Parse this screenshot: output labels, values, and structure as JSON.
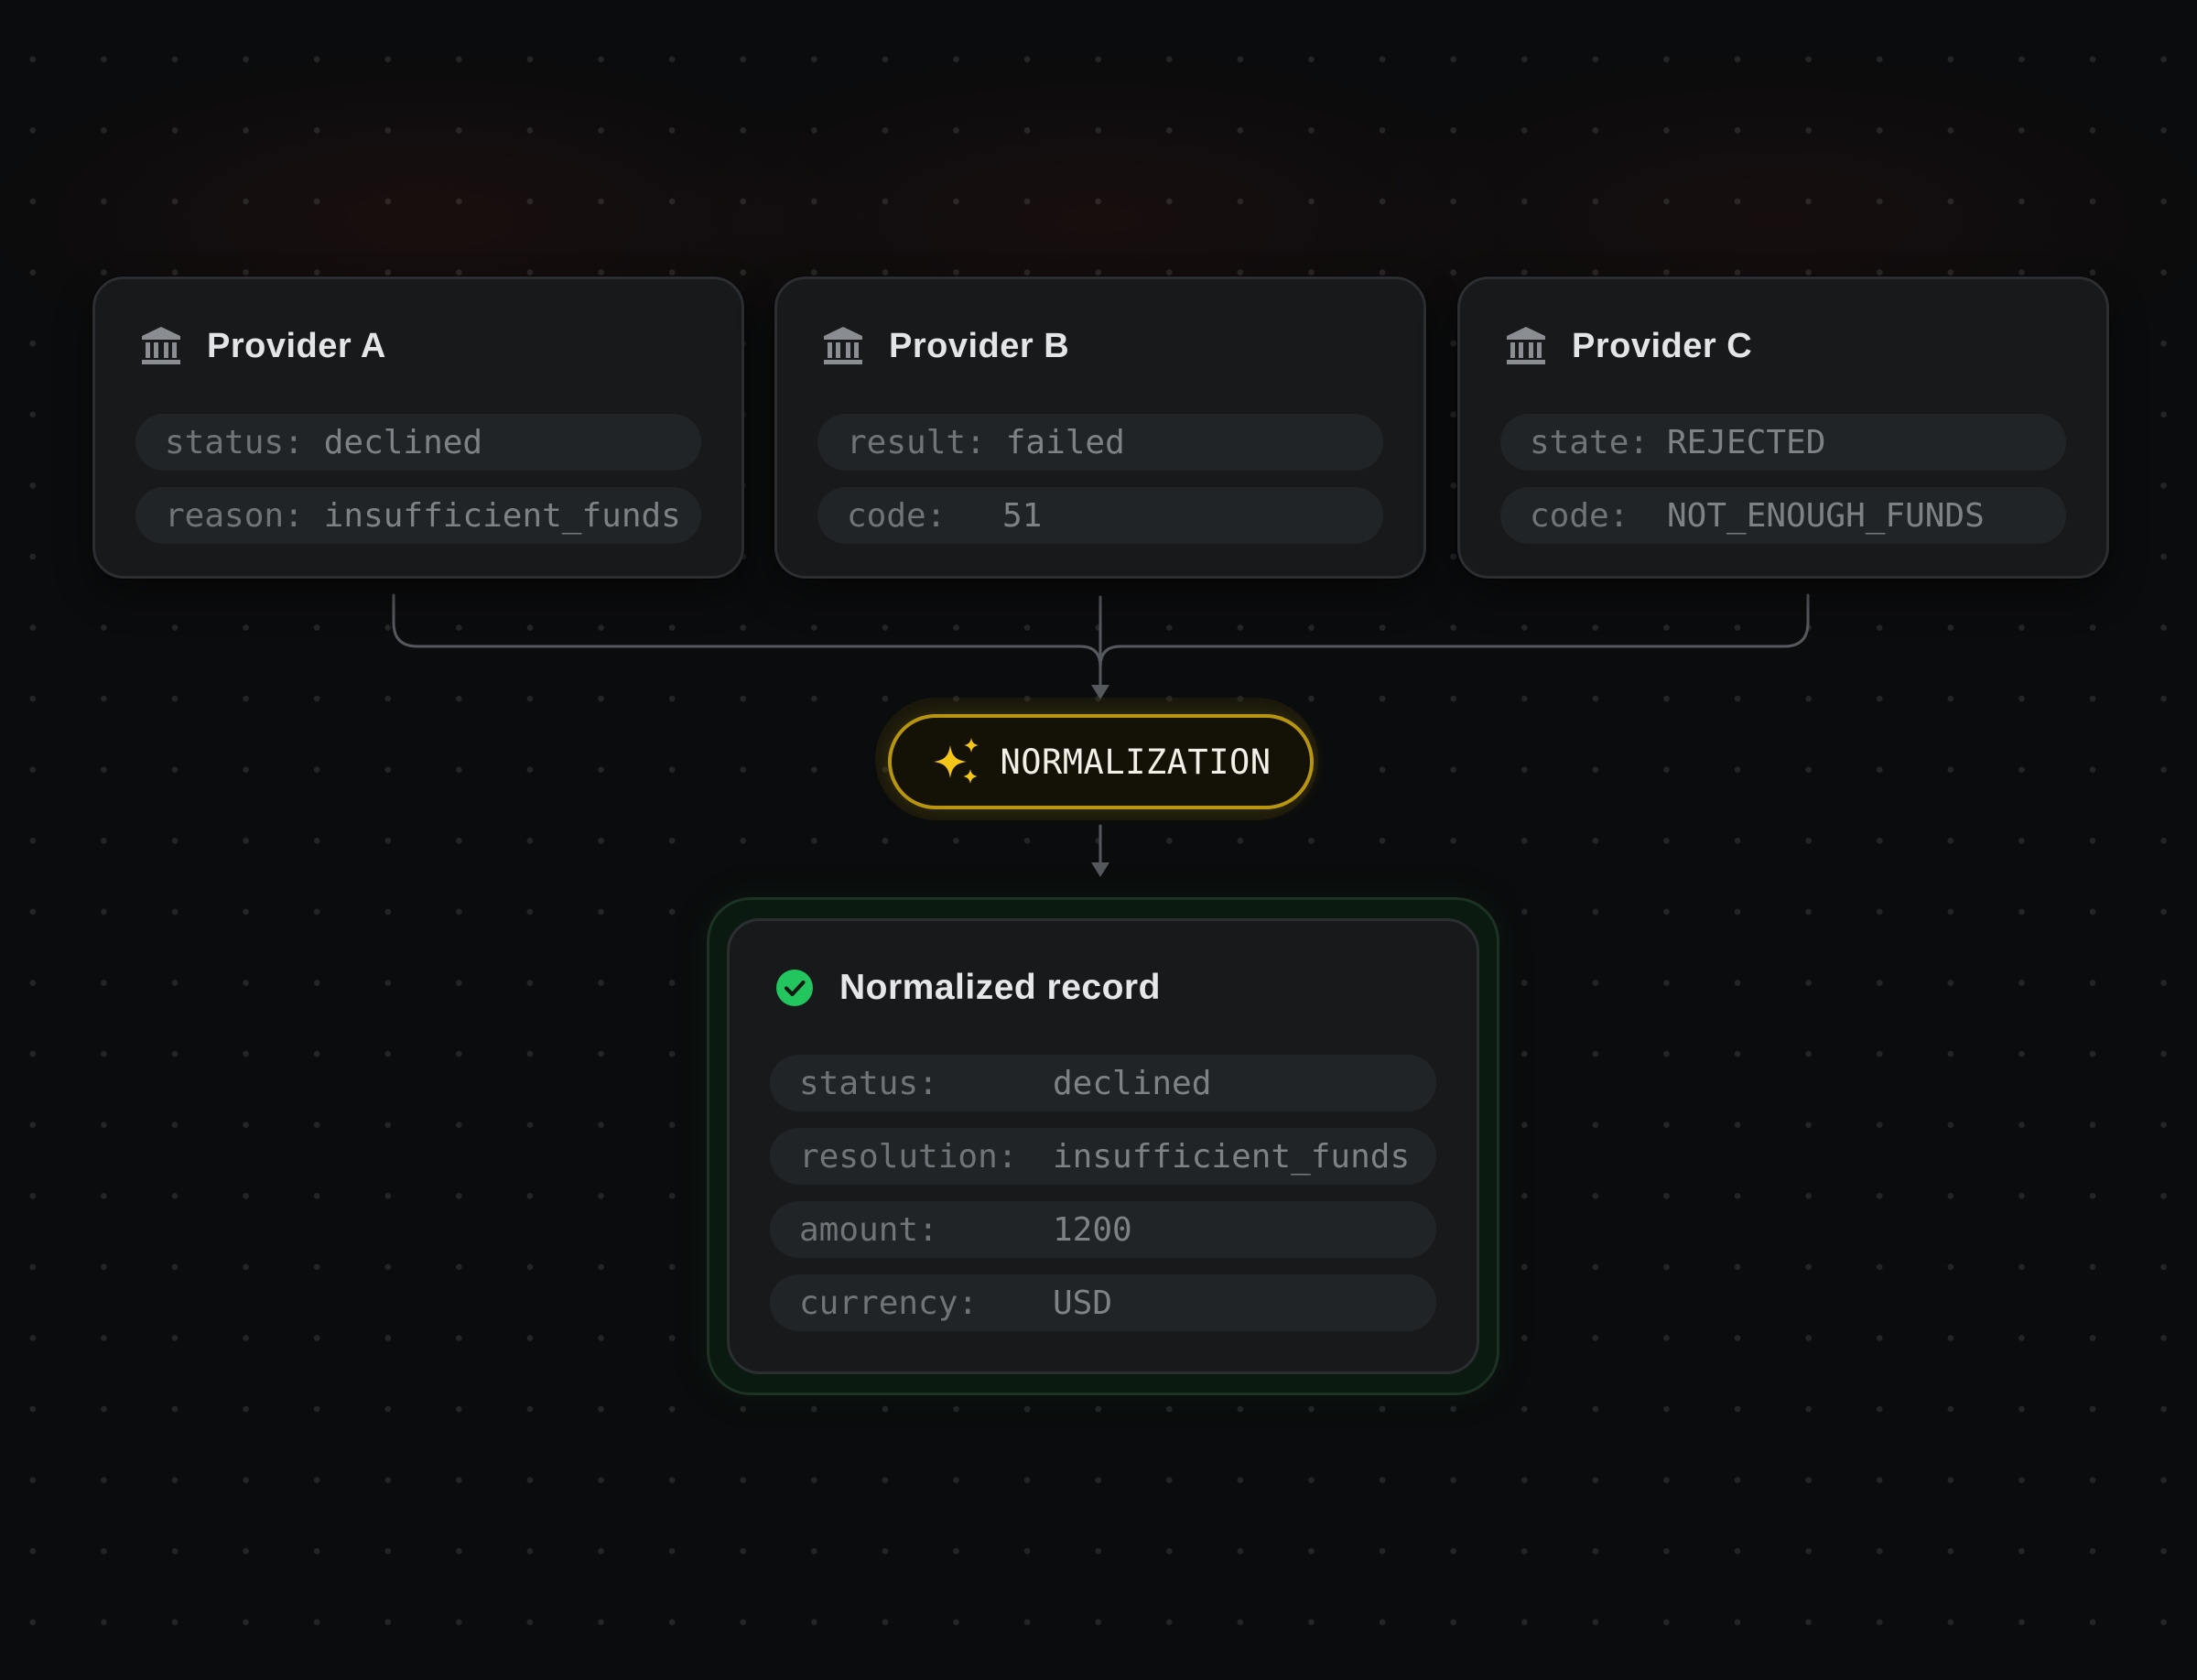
{
  "providers": [
    {
      "name": "Provider A",
      "icon": "bank-icon",
      "fields": [
        {
          "key": "status:",
          "value": "declined"
        },
        {
          "key": "reason:",
          "value": "insufficient_funds"
        }
      ]
    },
    {
      "name": "Provider B",
      "icon": "bank-icon",
      "fields": [
        {
          "key": "result:",
          "value": "failed"
        },
        {
          "key": "code:",
          "value": "51"
        }
      ]
    },
    {
      "name": "Provider C",
      "icon": "bank-icon",
      "fields": [
        {
          "key": "state:",
          "value": "REJECTED"
        },
        {
          "key": "code:",
          "value": "NOT_ENOUGH_FUNDS"
        }
      ]
    }
  ],
  "normalization": {
    "label": "NORMALIZATION",
    "icon": "sparkles-icon",
    "accent": "#f5c518"
  },
  "record": {
    "title": "Normalized record",
    "icon": "check-circle-icon",
    "status_color": "#22c55e",
    "fields": [
      {
        "key": "status:",
        "value": "declined"
      },
      {
        "key": "resolution:",
        "value": "insufficient_funds"
      },
      {
        "key": "amount:",
        "value": "1200"
      },
      {
        "key": "currency:",
        "value": "USD"
      }
    ]
  }
}
